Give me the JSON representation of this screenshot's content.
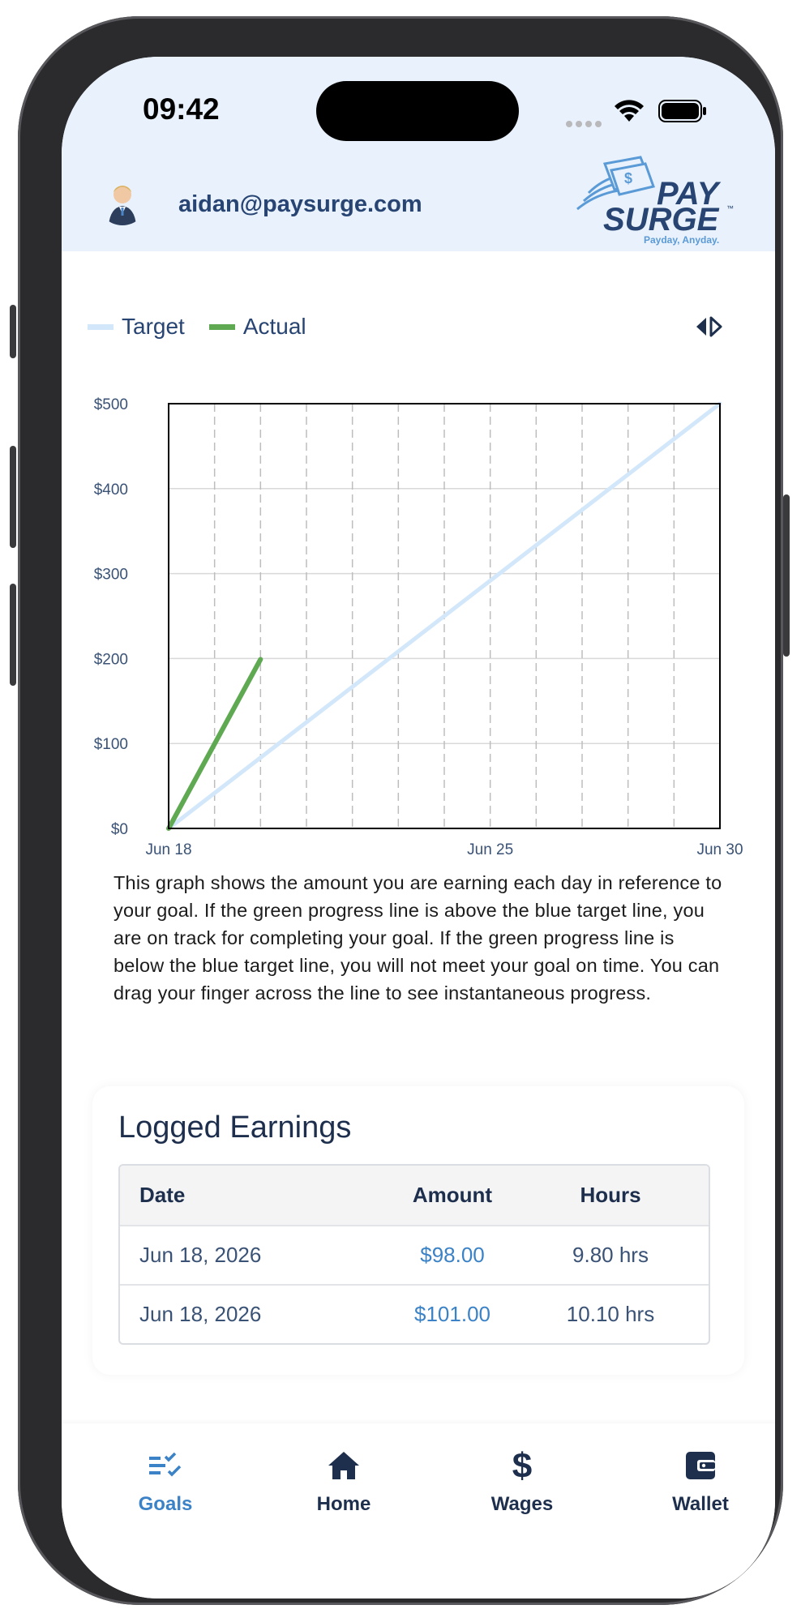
{
  "status_bar": {
    "time": "09:42"
  },
  "header": {
    "email": "aidan@paysurge.com",
    "logo": {
      "line1": "PAY",
      "line2": "SURGE",
      "tagline": "Payday, Anyday.",
      "tm": "™"
    }
  },
  "legend": {
    "target_label": "Target",
    "actual_label": "Actual",
    "target_color": "#d3e7fb",
    "actual_color": "#5fa952"
  },
  "chart_data": {
    "type": "line",
    "x_ticks": [
      "Jun 18",
      "Jun 25",
      "Jun 30"
    ],
    "y_ticks": [
      "$0",
      "$100",
      "$200",
      "$300",
      "$400",
      "$500"
    ],
    "ylim": [
      0,
      500
    ],
    "x_range": [
      "2026-06-18",
      "2026-06-30"
    ],
    "grid": true,
    "series": [
      {
        "name": "Target",
        "color": "#d3e7fb",
        "points": [
          [
            "2026-06-18",
            0
          ],
          [
            "2026-06-30",
            500
          ]
        ]
      },
      {
        "name": "Actual",
        "color": "#5fa952",
        "points": [
          [
            "2026-06-18",
            0
          ],
          [
            "2026-06-20",
            199
          ]
        ]
      }
    ]
  },
  "description": "This graph shows the amount you are earning each day in reference to your goal. If the green progress line is above the blue target line, you are on track for completing your goal. If the green progress line is below the blue target line, you will not meet your goal on time. You can drag your finger across the line to see instantaneous progress.",
  "logged_earnings": {
    "title": "Logged Earnings",
    "columns": [
      "Date",
      "Amount",
      "Hours"
    ],
    "rows": [
      {
        "date": "Jun 18, 2026",
        "amount": "$98.00",
        "hours": "9.80 hrs"
      },
      {
        "date": "Jun 18, 2026",
        "amount": "$101.00",
        "hours": "10.10 hrs"
      }
    ]
  },
  "tabs": [
    {
      "label": "Goals",
      "icon": "goals-checklist-icon",
      "active": true
    },
    {
      "label": "Home",
      "icon": "home-icon",
      "active": false
    },
    {
      "label": "Wages",
      "icon": "dollar-icon",
      "active": false
    },
    {
      "label": "Wallet",
      "icon": "wallet-icon",
      "active": false
    }
  ]
}
